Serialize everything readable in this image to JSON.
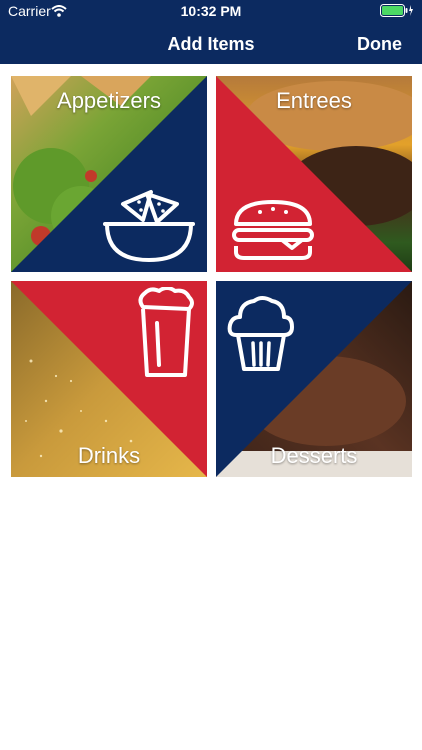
{
  "status_bar": {
    "carrier": "Carrier",
    "time": "10:32 PM"
  },
  "nav": {
    "title": "Add Items",
    "done_label": "Done"
  },
  "categories": {
    "appetizers": {
      "label": "Appetizers"
    },
    "entrees": {
      "label": "Entrees"
    },
    "drinks": {
      "label": "Drinks"
    },
    "desserts": {
      "label": "Desserts"
    }
  },
  "colors": {
    "navy": "#0c2a60",
    "red": "#d22333"
  }
}
